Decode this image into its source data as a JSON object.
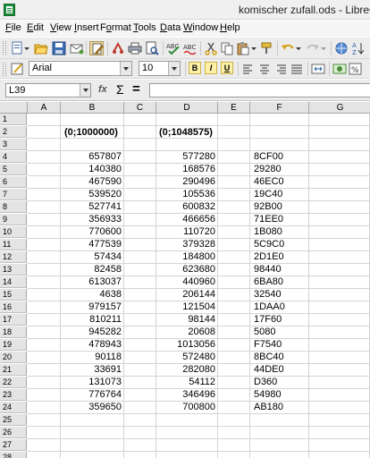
{
  "window": {
    "title": "komischer zufall.ods - LibreC"
  },
  "menu": [
    {
      "label": "File",
      "u": "F",
      "rest": "ile"
    },
    {
      "label": "Edit",
      "u": "E",
      "rest": "dit"
    },
    {
      "label": "View",
      "u": "V",
      "rest": "iew"
    },
    {
      "label": "Insert",
      "u": "I",
      "rest": "nsert"
    },
    {
      "label": "Format",
      "pre": "F",
      "u": "o",
      "rest": "rmat"
    },
    {
      "label": "Tools",
      "u": "T",
      "rest": "ools"
    },
    {
      "label": "Data",
      "u": "D",
      "rest": "ata"
    },
    {
      "label": "Window",
      "u": "W",
      "rest": "indow"
    },
    {
      "label": "Help",
      "u": "H",
      "rest": "elp"
    }
  ],
  "formatting": {
    "font_name": "Arial",
    "font_size": "10"
  },
  "formula_bar": {
    "name_box": "L39",
    "fx": "fx",
    "sum": "Σ",
    "equals": "=",
    "formula": ""
  },
  "columns": [
    "A",
    "B",
    "C",
    "D",
    "E",
    "F",
    "G"
  ],
  "rows": [
    "1",
    "2",
    "3",
    "4",
    "5",
    "6",
    "7",
    "8",
    "9",
    "10",
    "11",
    "12",
    "13",
    "14",
    "15",
    "16",
    "17",
    "18",
    "19",
    "20",
    "21",
    "22",
    "23",
    "24",
    "25",
    "26",
    "27",
    "28"
  ],
  "headers": {
    "B2": "(0;1000000)",
    "D2": "(0;1048575)"
  },
  "data_rows": [
    {
      "row": "4",
      "b": "657807",
      "d": "577280",
      "f": "8CF00"
    },
    {
      "row": "5",
      "b": "140380",
      "d": "168576",
      "f": "29280"
    },
    {
      "row": "6",
      "b": "467590",
      "d": "290496",
      "f": "46EC0"
    },
    {
      "row": "7",
      "b": "539520",
      "d": "105536",
      "f": "19C40"
    },
    {
      "row": "8",
      "b": "527741",
      "d": "600832",
      "f": "92B00"
    },
    {
      "row": "9",
      "b": "356933",
      "d": "466656",
      "f": "71EE0"
    },
    {
      "row": "10",
      "b": "770600",
      "d": "110720",
      "f": "1B080"
    },
    {
      "row": "11",
      "b": "477539",
      "d": "379328",
      "f": "5C9C0"
    },
    {
      "row": "12",
      "b": "57434",
      "d": "184800",
      "f": "2D1E0"
    },
    {
      "row": "13",
      "b": "82458",
      "d": "623680",
      "f": "98440"
    },
    {
      "row": "14",
      "b": "613037",
      "d": "440960",
      "f": "6BA80"
    },
    {
      "row": "15",
      "b": "4638",
      "d": "206144",
      "f": "32540"
    },
    {
      "row": "16",
      "b": "979157",
      "d": "121504",
      "f": "1DAA0"
    },
    {
      "row": "17",
      "b": "810211",
      "d": "98144",
      "f": "17F60"
    },
    {
      "row": "18",
      "b": "945282",
      "d": "20608",
      "f": "5080"
    },
    {
      "row": "19",
      "b": "478943",
      "d": "1013056",
      "f": "F7540"
    },
    {
      "row": "20",
      "b": "90118",
      "d": "572480",
      "f": "8BC40"
    },
    {
      "row": "21",
      "b": "33691",
      "d": "282080",
      "f": "44DE0"
    },
    {
      "row": "22",
      "b": "131073",
      "d": "54112",
      "f": "D360"
    },
    {
      "row": "23",
      "b": "776764",
      "d": "346496",
      "f": "54980"
    },
    {
      "row": "24",
      "b": "359650",
      "d": "700800",
      "f": "AB180"
    }
  ],
  "icons": [
    "new-icon",
    "open-icon",
    "save-icon",
    "email-icon",
    "edit-file-icon",
    "export-pdf-icon",
    "print-icon",
    "print-preview-icon",
    "spellcheck-icon",
    "autospell-icon",
    "cut-icon",
    "copy-icon",
    "paste-icon",
    "clone-format-icon",
    "undo-icon",
    "redo-icon",
    "hyperlink-icon",
    "sort-ascending-icon",
    "styles-icon",
    "bold-icon",
    "italic-icon",
    "underline-icon",
    "align-left-icon",
    "align-center-icon",
    "align-right-icon",
    "justify-icon",
    "merge-icon",
    "percent-icon"
  ]
}
